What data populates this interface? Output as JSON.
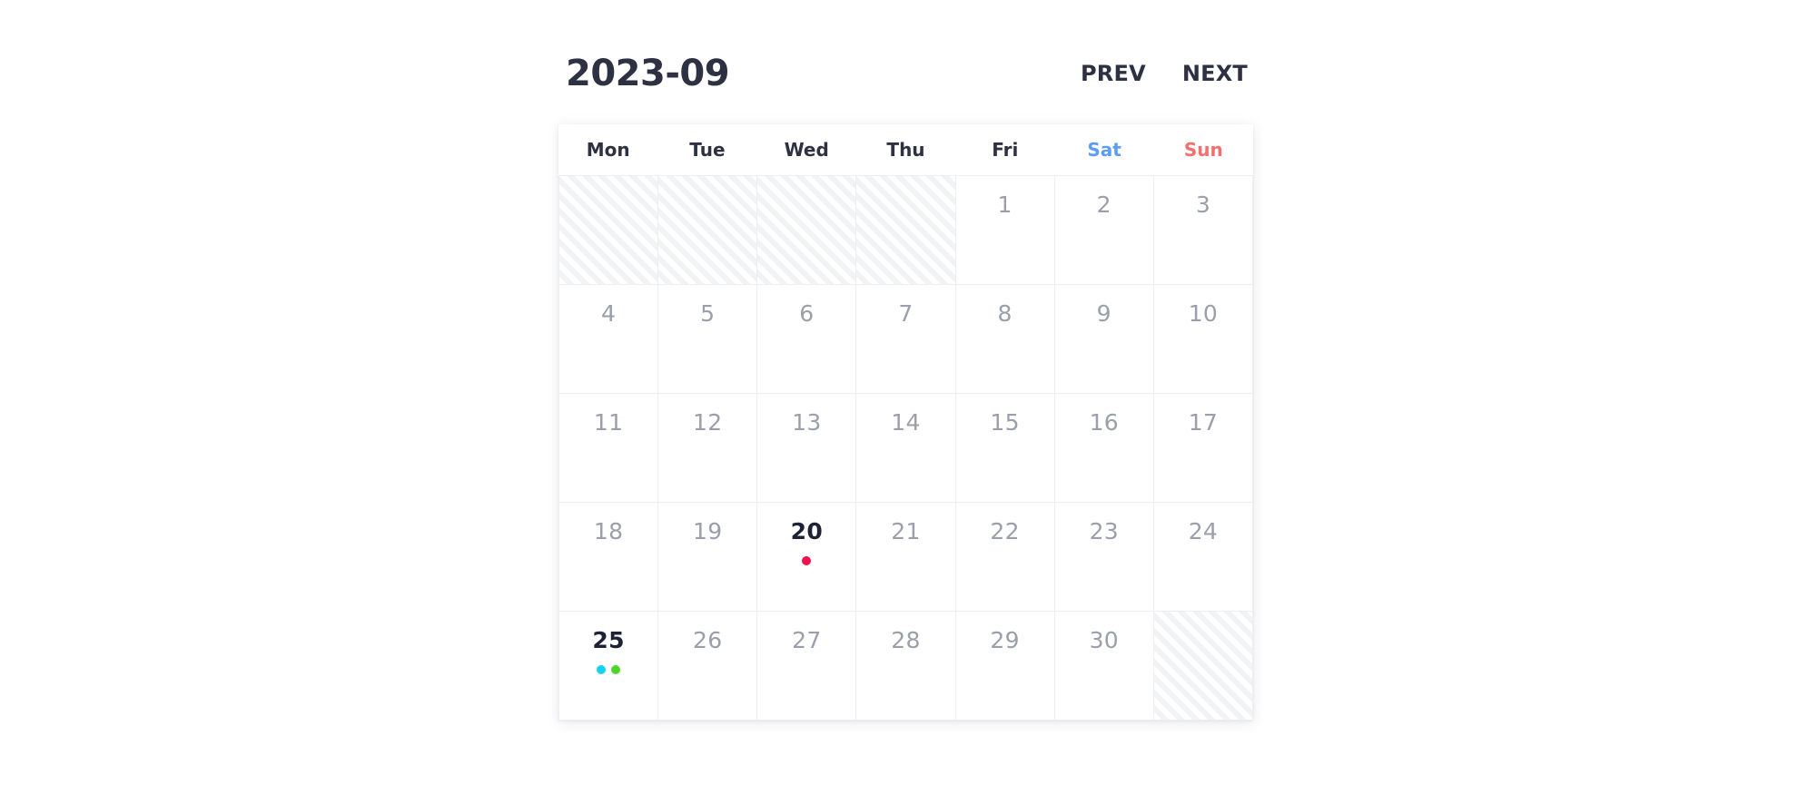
{
  "header": {
    "title": "2023-09",
    "prev_label": "PREV",
    "next_label": "NEXT"
  },
  "weekdays": [
    {
      "label": "Mon",
      "type": "weekday"
    },
    {
      "label": "Tue",
      "type": "weekday"
    },
    {
      "label": "Wed",
      "type": "weekday"
    },
    {
      "label": "Thu",
      "type": "weekday"
    },
    {
      "label": "Fri",
      "type": "weekday"
    },
    {
      "label": "Sat",
      "type": "saturday"
    },
    {
      "label": "Sun",
      "type": "sunday"
    }
  ],
  "colors": {
    "title": "#2d3142",
    "saturday": "#5b9df9",
    "sunday": "#f4706e",
    "daynum": "#9a9faa",
    "daynum_marked": "#1d2235",
    "grid_border": "#eceef1",
    "hatch": "#f2f3f5",
    "dot_red": "#f0124a",
    "dot_cyan": "#15d1f2",
    "dot_green": "#4cd62b"
  },
  "weeks": [
    [
      {
        "day": "",
        "blank": true
      },
      {
        "day": "",
        "blank": true
      },
      {
        "day": "",
        "blank": true
      },
      {
        "day": "",
        "blank": true
      },
      {
        "day": "1",
        "blank": false,
        "dots": []
      },
      {
        "day": "2",
        "blank": false,
        "dots": []
      },
      {
        "day": "3",
        "blank": false,
        "dots": []
      }
    ],
    [
      {
        "day": "4",
        "blank": false,
        "dots": []
      },
      {
        "day": "5",
        "blank": false,
        "dots": []
      },
      {
        "day": "6",
        "blank": false,
        "dots": []
      },
      {
        "day": "7",
        "blank": false,
        "dots": []
      },
      {
        "day": "8",
        "blank": false,
        "dots": []
      },
      {
        "day": "9",
        "blank": false,
        "dots": []
      },
      {
        "day": "10",
        "blank": false,
        "dots": []
      }
    ],
    [
      {
        "day": "11",
        "blank": false,
        "dots": []
      },
      {
        "day": "12",
        "blank": false,
        "dots": []
      },
      {
        "day": "13",
        "blank": false,
        "dots": []
      },
      {
        "day": "14",
        "blank": false,
        "dots": []
      },
      {
        "day": "15",
        "blank": false,
        "dots": []
      },
      {
        "day": "16",
        "blank": false,
        "dots": []
      },
      {
        "day": "17",
        "blank": false,
        "dots": []
      }
    ],
    [
      {
        "day": "18",
        "blank": false,
        "dots": []
      },
      {
        "day": "19",
        "blank": false,
        "dots": []
      },
      {
        "day": "20",
        "blank": false,
        "dots": [
          "#f0124a"
        ]
      },
      {
        "day": "21",
        "blank": false,
        "dots": []
      },
      {
        "day": "22",
        "blank": false,
        "dots": []
      },
      {
        "day": "23",
        "blank": false,
        "dots": []
      },
      {
        "day": "24",
        "blank": false,
        "dots": []
      }
    ],
    [
      {
        "day": "25",
        "blank": false,
        "dots": [
          "#15d1f2",
          "#4cd62b"
        ]
      },
      {
        "day": "26",
        "blank": false,
        "dots": []
      },
      {
        "day": "27",
        "blank": false,
        "dots": []
      },
      {
        "day": "28",
        "blank": false,
        "dots": []
      },
      {
        "day": "29",
        "blank": false,
        "dots": []
      },
      {
        "day": "30",
        "blank": false,
        "dots": []
      },
      {
        "day": "",
        "blank": true
      }
    ]
  ]
}
